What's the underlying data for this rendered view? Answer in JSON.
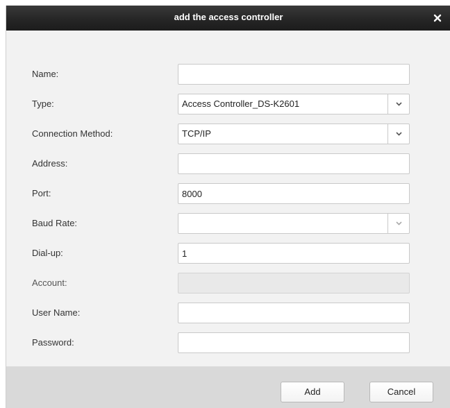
{
  "dialog": {
    "title": "add the access controller",
    "close_icon": "close-icon"
  },
  "form": {
    "name": {
      "label": "Name:",
      "value": ""
    },
    "type": {
      "label": "Type:",
      "value": "Access Controller_DS-K2601"
    },
    "connection_method": {
      "label": "Connection Method:",
      "value": "TCP/IP"
    },
    "address": {
      "label": "Address:",
      "value": ""
    },
    "port": {
      "label": "Port:",
      "value": "8000"
    },
    "baud_rate": {
      "label": "Baud Rate:",
      "value": ""
    },
    "dial_up": {
      "label": "Dial-up:",
      "value": "1"
    },
    "account": {
      "label": "Account:",
      "value": ""
    },
    "user_name": {
      "label": "User Name:",
      "value": ""
    },
    "password": {
      "label": "Password:",
      "value": ""
    }
  },
  "footer": {
    "add_label": "Add",
    "cancel_label": "Cancel"
  },
  "colors": {
    "titlebar": "#262626",
    "form_background": "#f2f2f2",
    "footer_background": "#d9d9d9"
  }
}
